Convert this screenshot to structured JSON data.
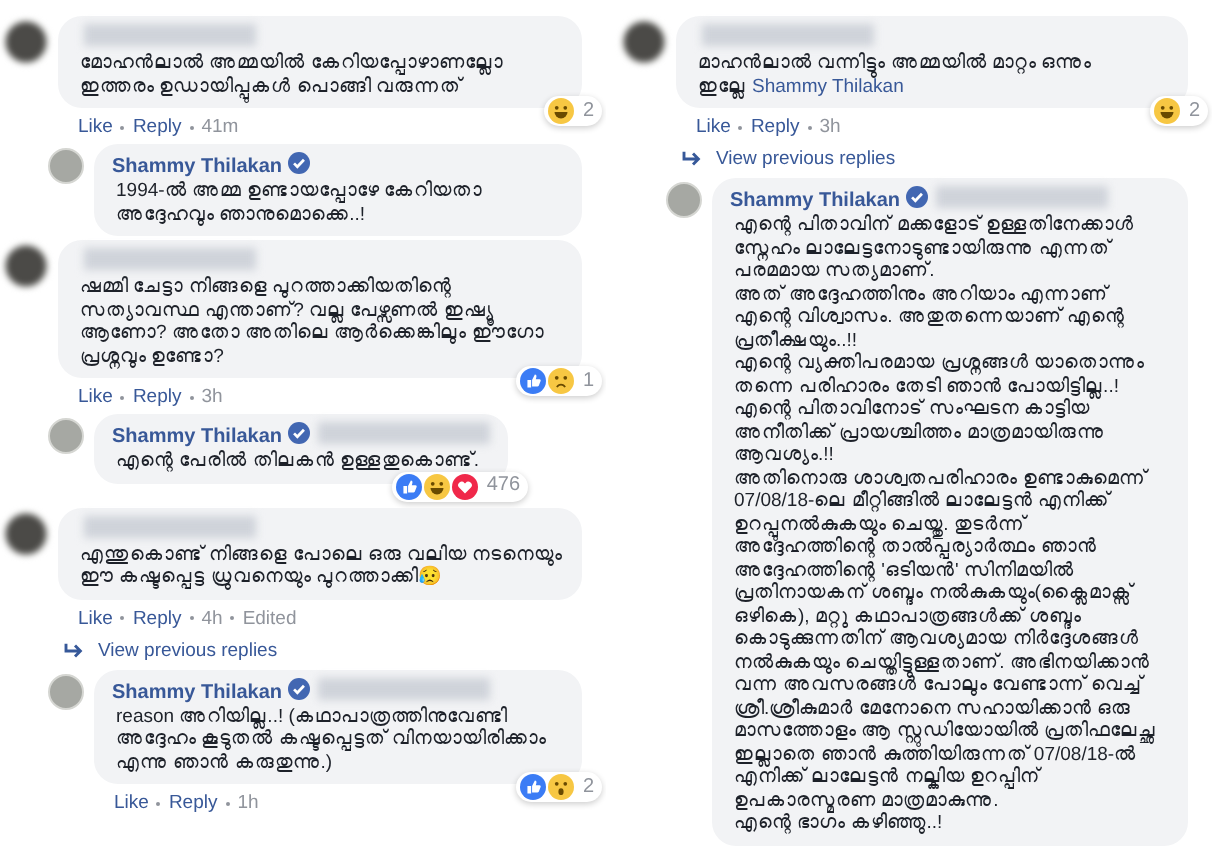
{
  "columns": [
    {
      "comments": [
        {
          "kind": "comment",
          "avatar_blurred": true,
          "redacted": true,
          "verified": false,
          "text": "മോഹൻലാൽ അമ്മയിൽ കേറിയപ്പോഴാണല്ലോ ഇത്തരം ഉഡായിപ്പുകൾ പൊങ്ങി വരുന്നത്",
          "reactions": {
            "kinds": [
              {
                "kind": "haha"
              }
            ],
            "count": "2"
          },
          "actions": [
            "Like",
            "Reply"
          ],
          "time": "41m",
          "replies": [
            {
              "kind": "comment",
              "avatar_blurred": false,
              "author": "Shammy Thilakan",
              "verified": true,
              "redacted": false,
              "text": "1994-ൽ അമ്മ ഉണ്ടായപ്പോഴേ കേറിയതാ അദ്ദേഹവും ഞാനുമൊക്കെ..!"
            }
          ]
        },
        {
          "kind": "comment",
          "avatar_blurred": true,
          "redacted": true,
          "verified": false,
          "text": "ഷമ്മി ചേട്ടാ നിങ്ങളെ പുറത്താക്കിയതിന്റെ സത്യാവസ്ഥ എന്താണ്? വല്ല പേഴ്സണൽ ഇഷ്യൂ ആണോ? അതോ അതിലെ ആർക്കെങ്കിലും ഈഗോ പ്രശ്നവും ഉണ്ടോ?",
          "reactions": {
            "kinds": [
              {
                "kind": "like"
              },
              {
                "kind": "sad"
              }
            ],
            "count": "1"
          },
          "actions": [
            "Like",
            "Reply"
          ],
          "time": "3h",
          "replies": [
            {
              "kind": "comment",
              "avatar_blurred": false,
              "author": "Shammy Thilakan",
              "verified": true,
              "redacted": true,
              "text": "എന്റെ പേരിൽ തിലകൻ ഉള്ളതുകൊണ്ട്.",
              "reactions": {
                "kinds": [
                  {
                    "kind": "like"
                  },
                  {
                    "kind": "haha"
                  },
                  {
                    "kind": "love"
                  }
                ],
                "count": "476"
              }
            }
          ]
        },
        {
          "kind": "comment",
          "avatar_blurred": true,
          "redacted": true,
          "verified": false,
          "text": "എന്തുകൊണ്ട് നിങ്ങളെ പോലെ ഒരു വലിയ നടനെയും ഈ കഷ്ടപ്പെട്ട ധ്രുവനെയും പുറത്താക്കി😥",
          "actions": [
            "Like",
            "Reply"
          ],
          "time": "4h",
          "note": "Edited",
          "replies": [
            {
              "kind": "more",
              "label": "View previous replies"
            },
            {
              "kind": "comment",
              "avatar_blurred": false,
              "author": "Shammy Thilakan",
              "verified": true,
              "redacted": true,
              "text": "reason അറിയില്ല..! (കഥാപാത്രത്തിനുവേണ്ടി അദ്ദേഹം കൂടുതൽ കഷ്ടപ്പെട്ടത് വിനയായിരിക്കാം എന്നു ഞാൻ കരുതുന്നു.)",
              "reactions": {
                "kinds": [
                  {
                    "kind": "like"
                  },
                  {
                    "kind": "wow"
                  }
                ],
                "count": "2"
              },
              "actions": [
                "Like",
                "Reply"
              ],
              "time": "1h"
            }
          ]
        }
      ]
    },
    {
      "comments": [
        {
          "kind": "comment",
          "avatar_blurred": true,
          "redacted": true,
          "verified": false,
          "text": "മാഹൻലാൽ വന്നിട്ടും അമ്മയിൽ മാറ്റം ഒന്നും ഇല്ലേ",
          "mention": "Shammy Thilakan",
          "reactions": {
            "kinds": [
              {
                "kind": "haha"
              }
            ],
            "count": "2"
          },
          "actions": [
            "Like",
            "Reply"
          ],
          "time": "3h",
          "replies": [
            {
              "kind": "more",
              "label": "View previous replies"
            },
            {
              "kind": "comment",
              "avatar_blurred": false,
              "author": "Shammy Thilakan",
              "verified": true,
              "redacted": true,
              "text": "എന്റെ പിതാവിന് മക്കളോട് ഉള്ളതിനേക്കാൾ സ്നേഹം ലാലേട്ടനോടുണ്ടായിരുന്നു എന്നത് പരമമായ സത്യമാണ്.\nഅത് അദ്ദേഹത്തിനും അറിയാം എന്നാണ് എന്റെ വിശ്വാസം. അതുതന്നെയാണ് എന്റെ പ്രതീക്ഷയും..!!\nഎന്റെ വ്യക്തിപരമായ പ്രശ്നങ്ങൾ യാതൊന്നും തന്നെ പരിഹാരം തേടി ഞാൻ പോയിട്ടില്ല..!\nഎന്റെ പിതാവിനോട് സംഘടന കാട്ടിയ അനീതിക്ക് പ്രായശ്ചിത്തം മാത്രമായിരുന്നു ആവശ്യം.!!\nഅതിനൊരു ശാശ്വതപരിഹാരം ഉണ്ടാകുമെന്ന് 07/08/18-ലെ മീറ്റിങ്ങിൽ ലാലേട്ടൻ എനിക്ക് ഉറപ്പുനൽകുകയും ചെയ്തു. തുടർന്ന് അദ്ദേഹത്തിന്റെ താൽപ്പര്യാർത്ഥം ഞാൻ അദ്ദേഹത്തിന്റെ 'ഒടിയൻ' സിനിമയിൽ പ്രതിനായകന് ശബ്ദം നൽകുകയും(ക്ലൈമാക്സ് ഒഴികെ), മറ്റു കഥാപാത്രങ്ങൾക്ക് ശബ്ദം കൊടുക്കുന്നതിന് ആവശ്യമായ നിർദ്ദേശങ്ങൾ നൽകുകയും ചെയ്തിട്ടുള്ളതാണ്. അഭിനയിക്കാൻ വന്ന അവസരങ്ങൾ പോലും വേണ്ടാന്ന് വെച്ച് ശ്രീ.ശ്രീകുമാർ മേനോനെ സഹായിക്കാൻ ഒരു മാസത്തോളം ആ സ്റ്റുഡിയോയിൽ പ്രതിഫലേച്ഛ ഇല്ലാതെ ഞാൻ കുത്തിയിരുന്നത് 07/08/18-ൽ എനിക്ക് ലാലേട്ടൻ നല്കിയ ഉറപ്പിന് ഉപകാരസ്മരണ മാത്രമാകുന്നു.\nഎന്റെ ഭാഗം കഴിഞ്ഞു..!"
            }
          ]
        }
      ]
    }
  ]
}
